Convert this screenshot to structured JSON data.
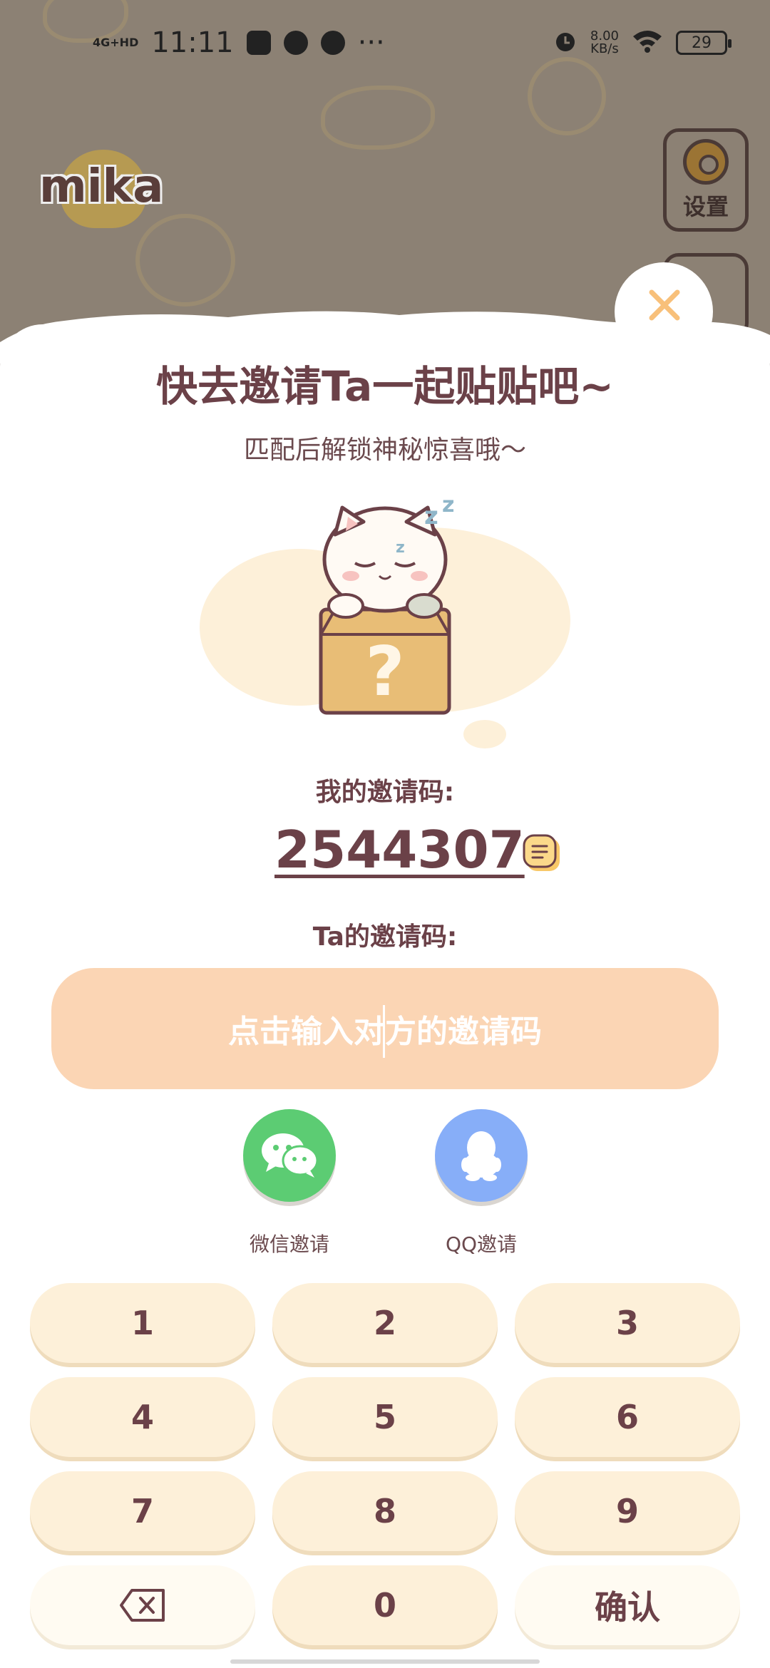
{
  "status_bar": {
    "network": "4G+HD",
    "time": "11:11",
    "speed_value": "8.00",
    "speed_unit": "KB/s",
    "battery": "29"
  },
  "background": {
    "logo_text": "mika",
    "settings_label": "设置"
  },
  "dialog": {
    "title": "快去邀请Ta一起贴贴吧~",
    "subtitle": "匹配后解锁神秘惊喜哦～",
    "my_code_label": "我的邀请码:",
    "my_code": "2544307",
    "ta_code_label": "Ta的邀请码:",
    "ta_code_placeholder": "点击输入对方的邀请码",
    "share": [
      {
        "label": "微信邀请",
        "icon": "wechat-icon",
        "color": "#5ccc73"
      },
      {
        "label": "QQ邀请",
        "icon": "qq-icon",
        "color": "#87aef8"
      }
    ]
  },
  "keypad": {
    "keys": [
      "1",
      "2",
      "3",
      "4",
      "5",
      "6",
      "7",
      "8",
      "9"
    ],
    "zero": "0",
    "confirm": "确认",
    "backspace_icon": "backspace-icon"
  },
  "colors": {
    "accent": "#6b4148",
    "input_bg": "#fbd5b4",
    "key_bg": "#fdf0d9",
    "close_icon": "#f8c07a"
  }
}
